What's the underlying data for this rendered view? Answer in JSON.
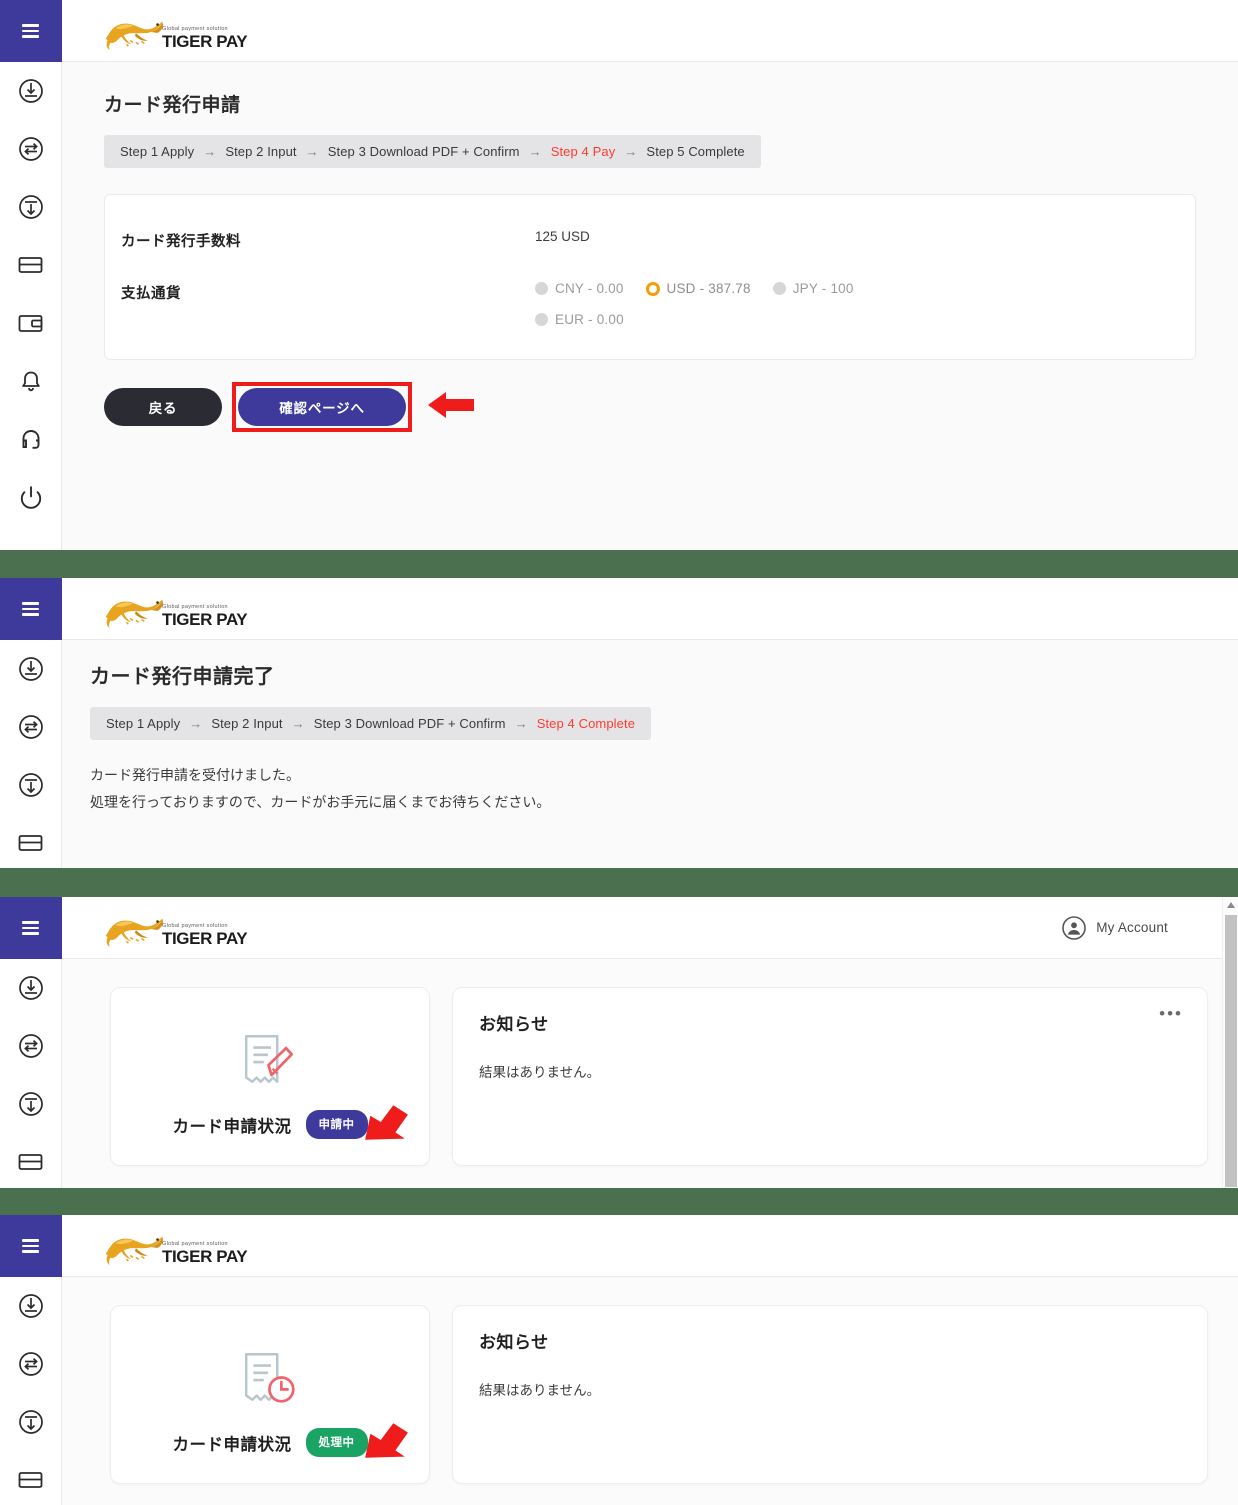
{
  "brand": {
    "name": "TIGER PAY",
    "tagline": "Global payment solution",
    "logo_icon": "tiger-logo-icon",
    "accent_indigo": "#3d3a9c",
    "accent_orange": "#f79b06",
    "accent_red": "#ff3b30",
    "badge_blue": "#3d3a9c",
    "badge_green": "#19a463",
    "separator_green": "#4a7050"
  },
  "sidebar": {
    "menu_icon": "hamburger-menu-icon",
    "items": [
      {
        "icon": "deposit-circle-arrow-in-icon",
        "label": "Deposit"
      },
      {
        "icon": "exchange-circle-arrows-icon",
        "label": "Exchange"
      },
      {
        "icon": "withdraw-circle-arrow-down-icon",
        "label": "Withdraw"
      },
      {
        "icon": "credit-card-icon",
        "label": "Card"
      },
      {
        "icon": "wallet-icon",
        "label": "Wallet"
      },
      {
        "icon": "bell-icon",
        "label": "Notifications"
      },
      {
        "icon": "headset-icon",
        "label": "Support"
      },
      {
        "icon": "power-icon",
        "label": "Logout"
      }
    ]
  },
  "panel1": {
    "title": "カード発行申請",
    "steps": [
      {
        "label": "Step 1 Apply",
        "current": false
      },
      {
        "label": "Step 2 Input",
        "current": false
      },
      {
        "label": "Step 3 Download PDF + Confirm",
        "current": false
      },
      {
        "label": "Step 4 Pay",
        "current": true
      },
      {
        "label": "Step 5 Complete",
        "current": false
      }
    ],
    "step_separator": "→",
    "fee_label": "カード発行手数料",
    "fee_value": "125 USD",
    "currency_label": "支払通貨",
    "currencies": [
      {
        "label": "CNY - 0.00",
        "selected": false
      },
      {
        "label": "USD - 387.78",
        "selected": true
      },
      {
        "label": "JPY - 100",
        "selected": false
      },
      {
        "label": "EUR - 0.00",
        "selected": false
      }
    ],
    "back_button": "戻る",
    "next_button": "確認ページへ",
    "highlight_color": "#ef1c1c",
    "pointer_icon": "red-arrow-left-icon"
  },
  "panel2": {
    "title": "カード発行申請完了",
    "steps": [
      {
        "label": "Step 1 Apply",
        "current": false
      },
      {
        "label": "Step 2 Input",
        "current": false
      },
      {
        "label": "Step 3 Download PDF + Confirm",
        "current": false
      },
      {
        "label": "Step 4 Complete",
        "current": true
      }
    ],
    "step_separator": "→",
    "message_line1": "カード発行申請を受付けました。",
    "message_line2": "処理を行っておりますので、カードがお手元に届くまでお待ちください。"
  },
  "panel3": {
    "account_label": "My Account",
    "account_icon": "user-circle-icon",
    "tile": {
      "icon": "document-pencil-icon",
      "title": "カード申請状況",
      "badge": "申請中",
      "badge_color": "#3d3a9c"
    },
    "notice": {
      "title": "お知らせ",
      "more_icon": "ellipsis-icon",
      "empty_text": "結果はありません。"
    },
    "pointer_icon": "red-arrow-diagonal-icon",
    "scrollbar": {
      "up_icon": "scroll-up-arrow-icon"
    }
  },
  "panel4": {
    "tile": {
      "icon": "document-clock-icon",
      "title": "カード申請状況",
      "badge": "処理中",
      "badge_color": "#19a463"
    },
    "notice": {
      "title": "お知らせ",
      "empty_text": "結果はありません。"
    },
    "pointer_icon": "red-arrow-diagonal-icon"
  }
}
